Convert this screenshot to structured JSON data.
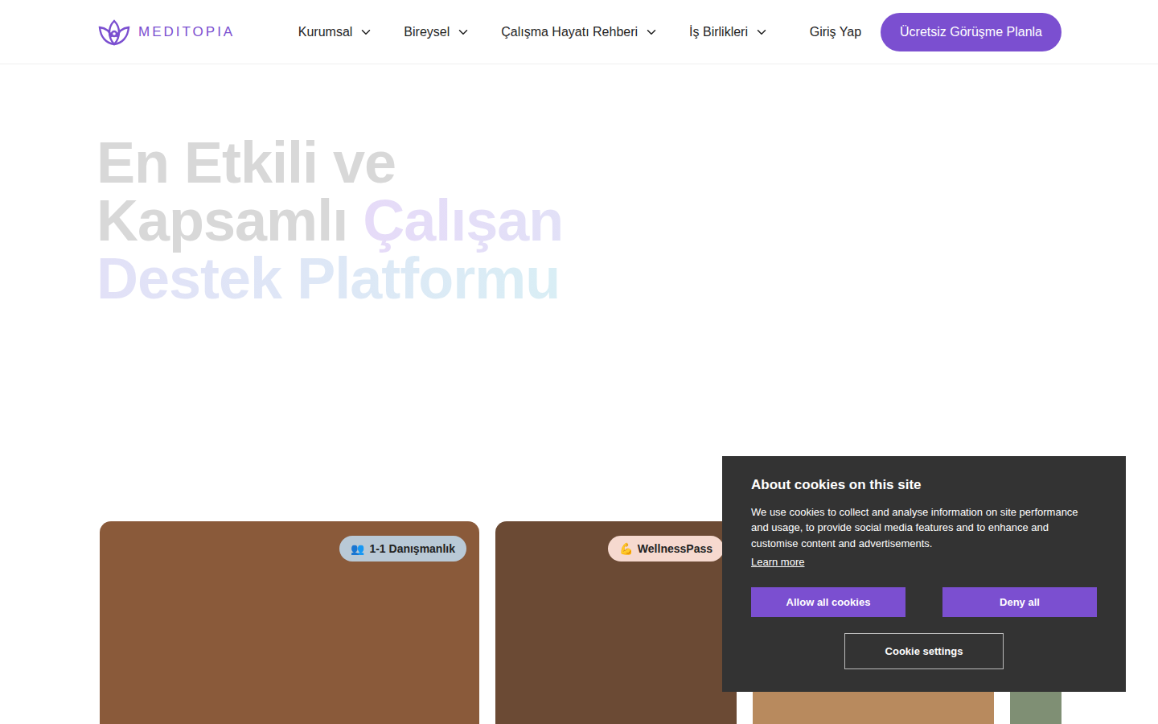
{
  "header": {
    "logo": "MEDITOPIA",
    "nav": [
      {
        "label": "Kurumsal",
        "expanded": false
      },
      {
        "label": "Bireysel",
        "expanded": false
      },
      {
        "label": "Çalışma Hayatı Rehberi",
        "expanded": false
      },
      {
        "label": "İş Birlikleri",
        "expanded": false
      }
    ],
    "login": "Giriş Yap",
    "cta": "Ücretsiz Görüşme Planla"
  },
  "hero": {
    "title_plain": "En Etkili ve Kapsamlı",
    "title_accent": "Çalışan Destek Platformu"
  },
  "cards": [
    {
      "badge_icon": "👥",
      "badge": "1-1 Danışmanlık",
      "badge_color": "#b9c9d6",
      "color": "#8a5a3a",
      "kind": "wide"
    },
    {
      "badge_icon": "💪",
      "badge": "WellnessPass",
      "badge_color": "#f6d9cf",
      "color": "#6b4a34",
      "kind": "normal"
    },
    {
      "badge_icon": "",
      "badge": "",
      "badge_color": "",
      "color": "#b88a5e",
      "kind": "normal"
    },
    {
      "badge_icon": "",
      "badge": "",
      "badge_color": "",
      "color": "#7f8f74",
      "kind": "normal"
    }
  ],
  "cookie": {
    "title": "About cookies on this site",
    "text": "We use cookies to collect and analyse information on site performance and usage, to provide social media features and to enhance and customise content and advertisements.",
    "learn_more": "Learn more",
    "allow": "Allow all cookies",
    "deny": "Deny all",
    "settings": "Cookie settings"
  }
}
